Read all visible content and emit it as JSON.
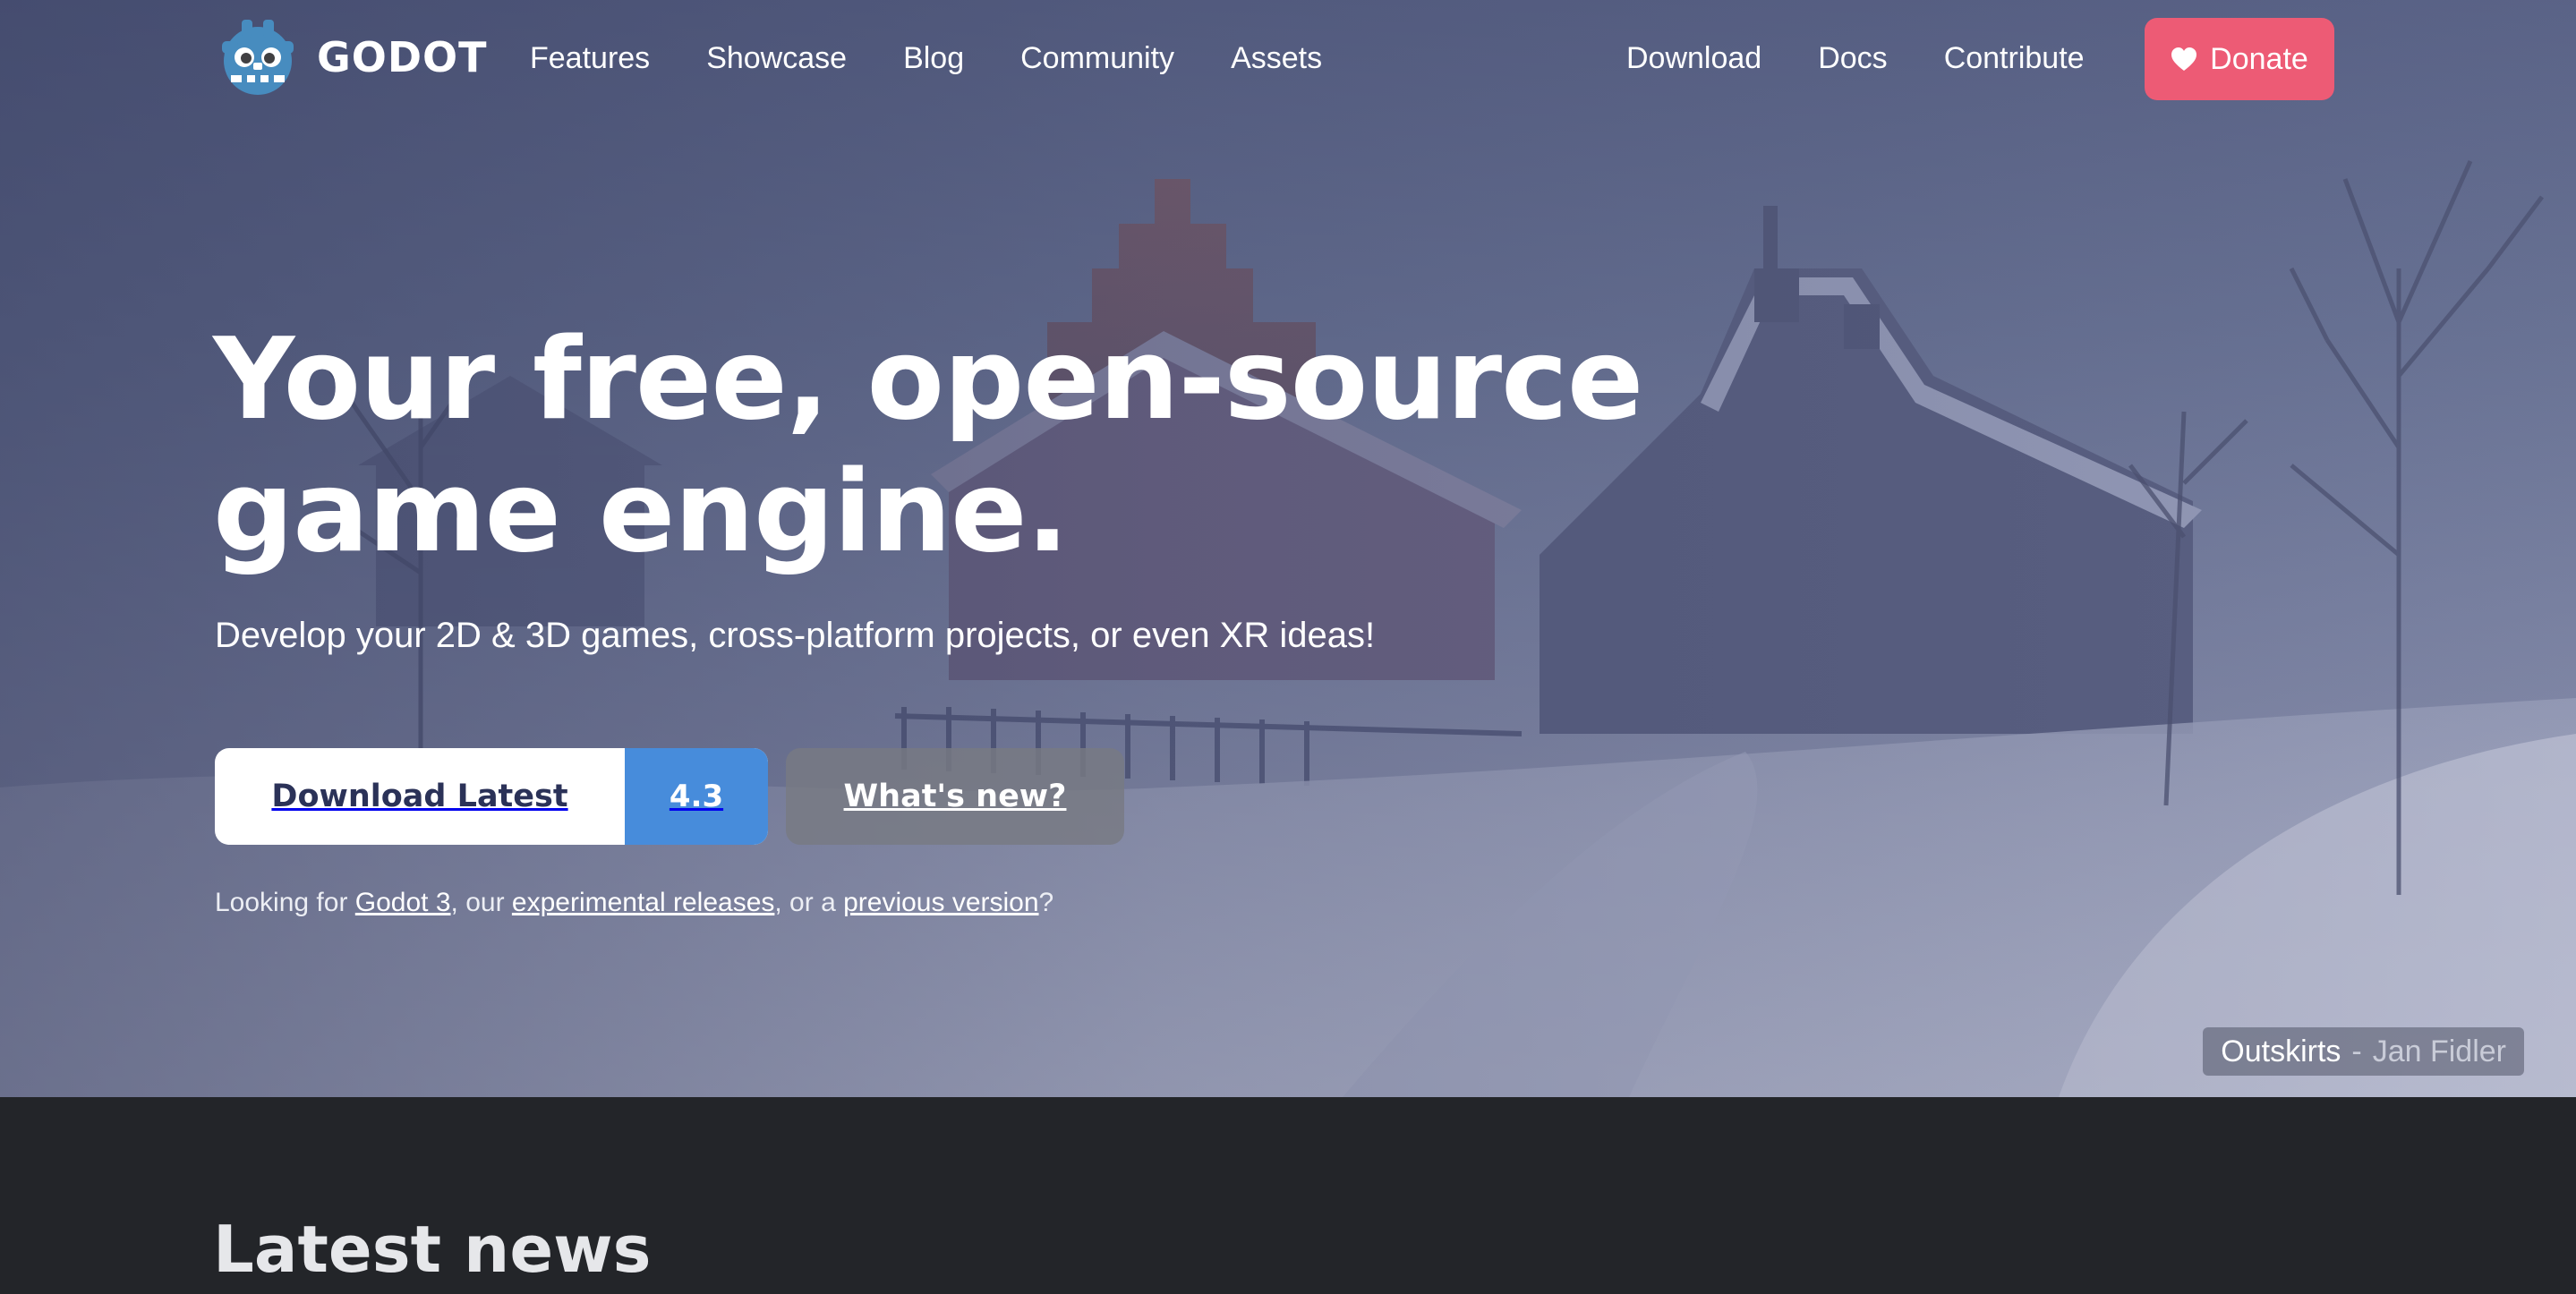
{
  "brand": {
    "name": "GODOT",
    "logo_icon": "godot-robot-icon"
  },
  "nav": {
    "left": [
      "Features",
      "Showcase",
      "Blog",
      "Community",
      "Assets"
    ],
    "right": [
      "Download",
      "Docs",
      "Contribute"
    ],
    "donate": "Donate"
  },
  "hero": {
    "headline_line1": "Your free, open-source",
    "headline_line2": "game engine.",
    "subhead": "Develop your 2D & 3D games, cross-platform projects, or even XR ideas!",
    "download_label": "Download Latest",
    "download_version": "4.3",
    "whats_new": "What's new?",
    "looking": {
      "prefix": "Looking for ",
      "link1": "Godot 3",
      "mid1": ", our ",
      "link2": "experimental releases",
      "mid2": ", or a ",
      "link3": "previous version",
      "suffix": "?"
    },
    "credit": {
      "work": "Outskirts",
      "separator": "-",
      "artist": "Jan Fidler"
    }
  },
  "news": {
    "title": "Latest news"
  },
  "colors": {
    "donate": "#ed5b75",
    "version_badge": "#478cdb",
    "download_text": "#2b3258",
    "news_bg": "#232529"
  }
}
